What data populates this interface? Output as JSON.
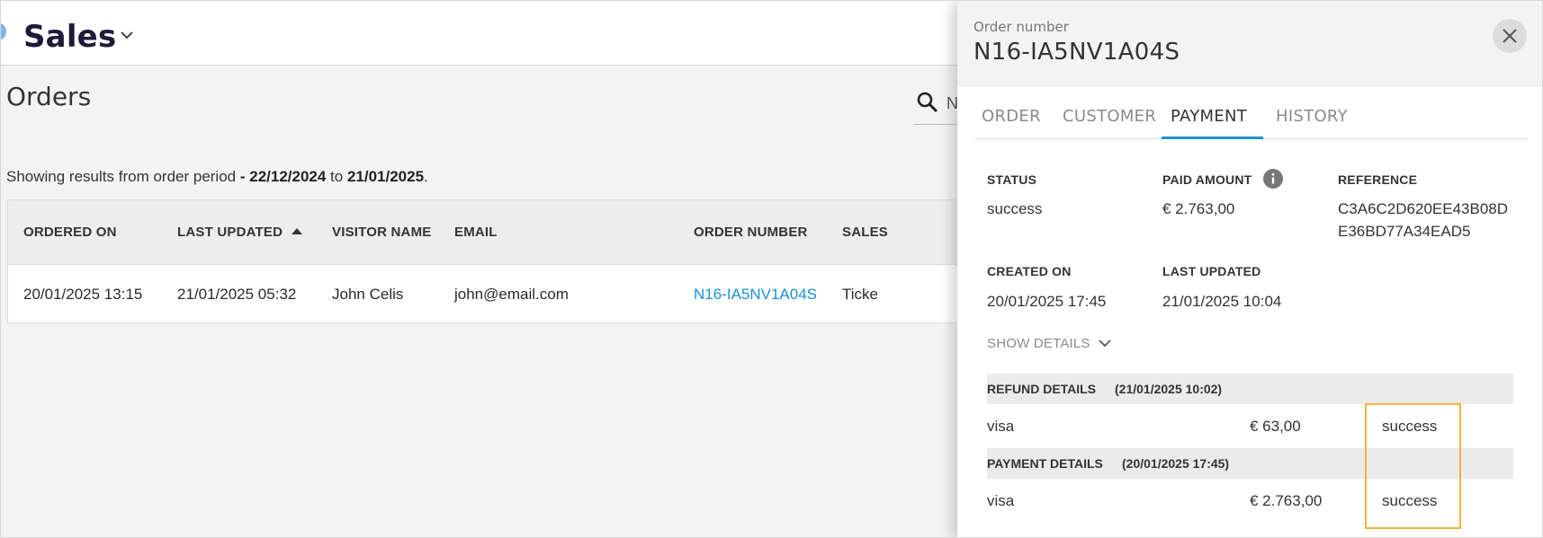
{
  "header": {
    "app_title": "Sales"
  },
  "page": {
    "title": "Orders",
    "search_text": "N",
    "period_prefix": "Showing results from order period",
    "period_dash": " - ",
    "period_from": "22/12/2024",
    "period_to_word": " to ",
    "period_to": "21/01/2025",
    "period_suffix": "."
  },
  "table": {
    "columns": [
      "ORDERED ON",
      "LAST UPDATED",
      "VISITOR NAME",
      "EMAIL",
      "ORDER NUMBER",
      "SALES"
    ],
    "rows": [
      {
        "ordered_on": "20/01/2025 13:15",
        "last_updated": "21/01/2025 05:32",
        "visitor_name": "John Celis",
        "email": "john@email.com",
        "order_number": "N16-IA5NV1A04S",
        "sales": "Ticke"
      }
    ]
  },
  "drawer": {
    "order_number_label": "Order number",
    "order_number": "N16-IA5NV1A04S",
    "tabs": [
      {
        "label": "ORDER"
      },
      {
        "label": "CUSTOMER"
      },
      {
        "label": "PAYMENT"
      },
      {
        "label": "HISTORY"
      }
    ],
    "active_tab": "PAYMENT",
    "status_label": "STATUS",
    "status_value": "success",
    "paid_amount_label": "PAID AMOUNT",
    "paid_amount_value": "€ 2.763,00",
    "reference_label": "REFERENCE",
    "reference_line1": "C3A6C2D620EE43B08D",
    "reference_line2": "E36BD77A34EAD5",
    "created_on_label": "CREATED ON",
    "created_on_value": "20/01/2025 17:45",
    "last_updated_label": "LAST UPDATED",
    "last_updated_value": "21/01/2025 10:04",
    "show_details_label": "SHOW DETAILS",
    "refund_title": "REFUND DETAILS",
    "refund_date": "(21/01/2025 10:02)",
    "refund_method": "visa",
    "refund_amount": "€ 63,00",
    "refund_status": "success",
    "payment_title": "PAYMENT DETAILS",
    "payment_date": "(20/01/2025 17:45)",
    "payment_method": "visa",
    "payment_amount": "€ 2.763,00",
    "payment_status": "success"
  },
  "colors": {
    "link": "#1b8fd8",
    "highlight_border": "#f0b43a",
    "tab_underline": "#1b8fd8"
  }
}
